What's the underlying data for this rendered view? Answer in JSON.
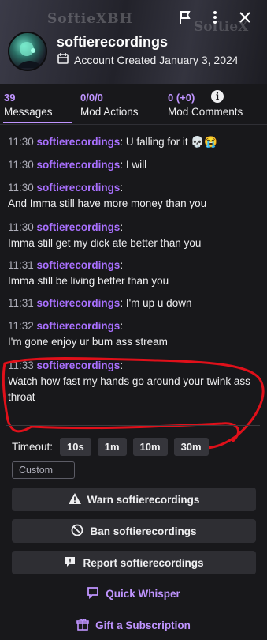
{
  "header": {
    "banner_left": "SoftieXBH",
    "banner_right": "SoftieX",
    "username": "softierecordings",
    "account_created": "Account Created January 3, 2024",
    "icons": [
      "flag-icon",
      "more-vertical-icon",
      "close-icon"
    ]
  },
  "tabs": [
    {
      "count": "39",
      "label": "Messages",
      "active": true
    },
    {
      "count": "0/0/0",
      "label": "Mod Actions",
      "active": false
    },
    {
      "count": "0 (+0)",
      "label": "Mod Comments",
      "active": false
    }
  ],
  "messages": [
    {
      "time": "11:30",
      "author": "softierecordings",
      "text": ": U falling for it 💀😭"
    },
    {
      "time": "11:30",
      "author": "softierecordings",
      "text": ": I will"
    },
    {
      "time": "11:30",
      "author": "softierecordings",
      "text": ":",
      "text2": "And Imma still have more money than you"
    },
    {
      "time": "11:30",
      "author": "softierecordings",
      "text": ":",
      "text2": "Imma still get my dick ate better than you"
    },
    {
      "time": "11:31",
      "author": "softierecordings",
      "text": ":",
      "text2": "Imma still be living better than you"
    },
    {
      "time": "11:31",
      "author": "softierecordings",
      "text": ": I'm up u down"
    },
    {
      "time": "11:32",
      "author": "softierecordings",
      "text": ":",
      "text2": "I'm gone enjoy ur bum ass stream"
    },
    {
      "time": "11:33",
      "author": "softierecordings",
      "text": ":",
      "text2": "Watch how fast my hands go around your twink ass throat"
    }
  ],
  "actions": {
    "timeout_label": "Timeout:",
    "timeout_options": [
      "10s",
      "1m",
      "10m",
      "30m"
    ],
    "custom_placeholder": "Custom",
    "warn": "Warn softierecordings",
    "ban": "Ban softierecordings",
    "report": "Report softierecordings",
    "whisper": "Quick Whisper",
    "gift": "Gift a Subscription"
  },
  "colors": {
    "background": "#18181b",
    "accent": "#a970ff",
    "button": "#2e2e33",
    "annotation": "#e0101a"
  }
}
